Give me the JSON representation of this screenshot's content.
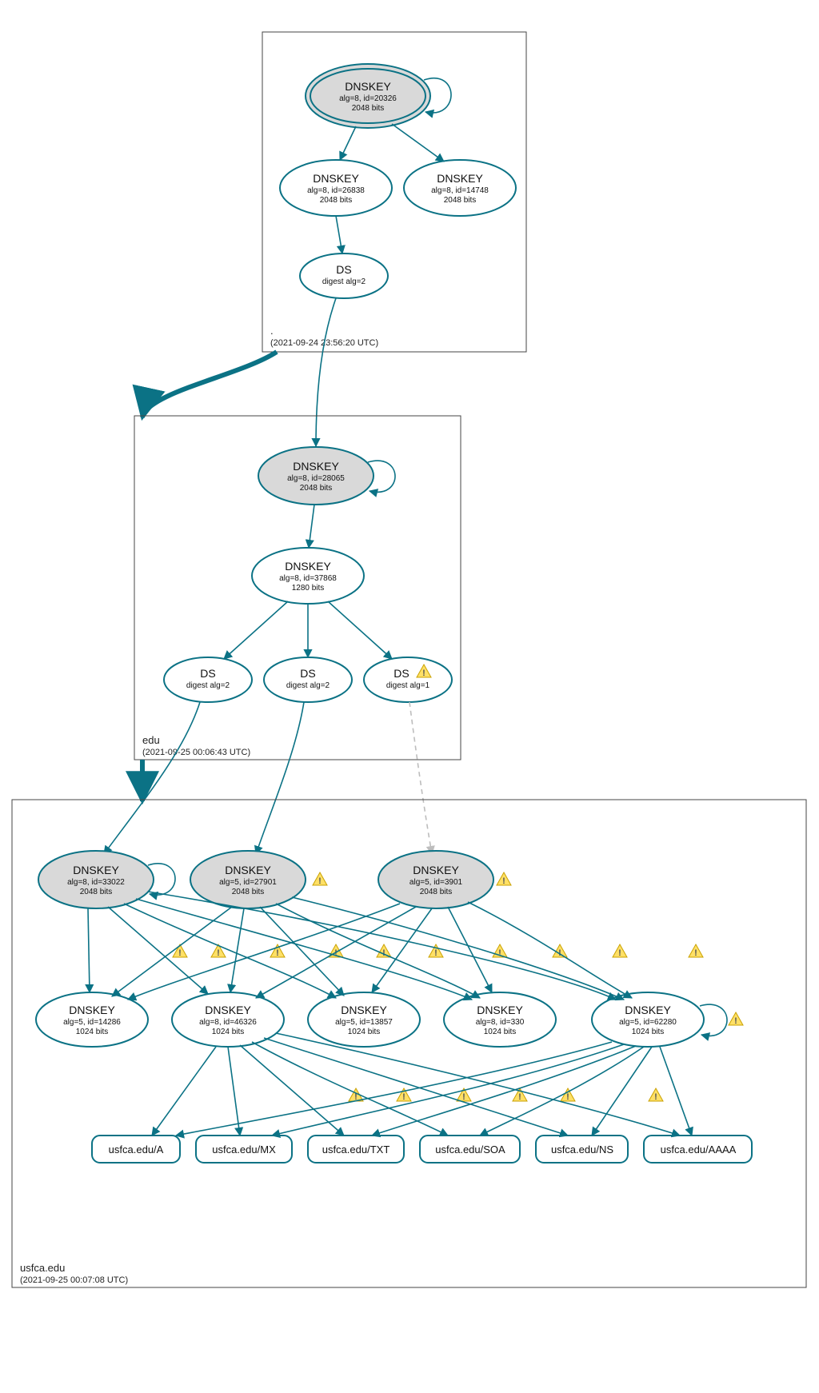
{
  "zones": {
    "root": {
      "label": ".",
      "timestamp": "(2021-09-24 23:56:20 UTC)"
    },
    "edu": {
      "label": "edu",
      "timestamp": "(2021-09-25 00:06:43 UTC)"
    },
    "usfca": {
      "label": "usfca.edu",
      "timestamp": "(2021-09-25 00:07:08 UTC)"
    }
  },
  "nodes": {
    "root_ksk": {
      "title": "DNSKEY",
      "line2": "alg=8, id=20326",
      "line3": "2048 bits"
    },
    "root_zsk1": {
      "title": "DNSKEY",
      "line2": "alg=8, id=26838",
      "line3": "2048 bits"
    },
    "root_zsk2": {
      "title": "DNSKEY",
      "line2": "alg=8, id=14748",
      "line3": "2048 bits"
    },
    "root_ds": {
      "title": "DS",
      "line2": "digest alg=2",
      "line3": ""
    },
    "edu_ksk": {
      "title": "DNSKEY",
      "line2": "alg=8, id=28065",
      "line3": "2048 bits"
    },
    "edu_zsk": {
      "title": "DNSKEY",
      "line2": "alg=8, id=37868",
      "line3": "1280 bits"
    },
    "edu_ds1": {
      "title": "DS",
      "line2": "digest alg=2",
      "line3": ""
    },
    "edu_ds2": {
      "title": "DS",
      "line2": "digest alg=2",
      "line3": ""
    },
    "edu_ds3": {
      "title": "DS",
      "line2": "digest alg=1",
      "line3": ""
    },
    "u_ksk1": {
      "title": "DNSKEY",
      "line2": "alg=8, id=33022",
      "line3": "2048 bits"
    },
    "u_ksk2": {
      "title": "DNSKEY",
      "line2": "alg=5, id=27901",
      "line3": "2048 bits"
    },
    "u_ksk3": {
      "title": "DNSKEY",
      "line2": "alg=5, id=3901",
      "line3": "2048 bits"
    },
    "u_zsk1": {
      "title": "DNSKEY",
      "line2": "alg=5, id=14286",
      "line3": "1024 bits"
    },
    "u_zsk2": {
      "title": "DNSKEY",
      "line2": "alg=8, id=46326",
      "line3": "1024 bits"
    },
    "u_zsk3": {
      "title": "DNSKEY",
      "line2": "alg=5, id=13857",
      "line3": "1024 bits"
    },
    "u_zsk4": {
      "title": "DNSKEY",
      "line2": "alg=8, id=330",
      "line3": "1024 bits"
    },
    "u_zsk5": {
      "title": "DNSKEY",
      "line2": "alg=5, id=62280",
      "line3": "1024 bits"
    }
  },
  "rrsets": {
    "a": "usfca.edu/A",
    "mx": "usfca.edu/MX",
    "txt": "usfca.edu/TXT",
    "soa": "usfca.edu/SOA",
    "ns": "usfca.edu/NS",
    "aaaa": "usfca.edu/AAAA"
  },
  "colors": {
    "edge": "#0b7285",
    "node_fill_grey": "#d9d9d9",
    "warn_fill": "#ffe066",
    "warn_stroke": "#c9a100"
  }
}
